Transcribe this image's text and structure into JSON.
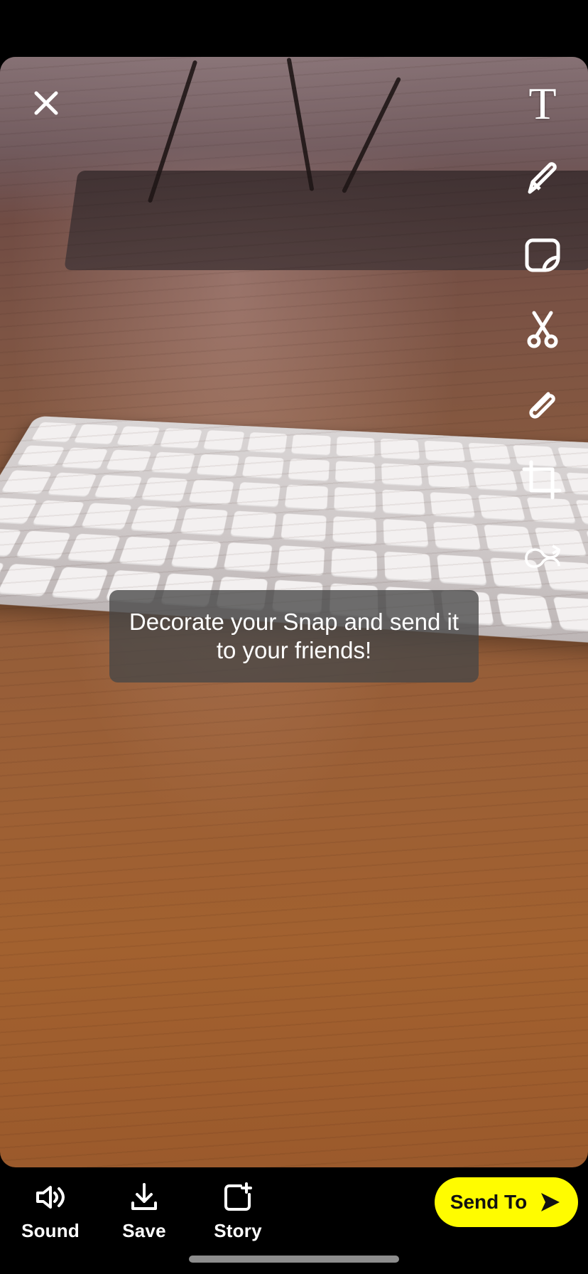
{
  "tooltip": {
    "text": "Decorate your Snap and send it to your friends!"
  },
  "toolbar_right": [
    {
      "name": "text-tool",
      "icon": "text-T-icon"
    },
    {
      "name": "pencil-tool",
      "icon": "pencil-icon"
    },
    {
      "name": "sticker-tool",
      "icon": "sticker-icon"
    },
    {
      "name": "scissors-tool",
      "icon": "scissors-icon"
    },
    {
      "name": "paperclip-tool",
      "icon": "paperclip-icon"
    },
    {
      "name": "crop-tool",
      "icon": "crop-icon"
    },
    {
      "name": "loop-tool",
      "icon": "loop-icon"
    }
  ],
  "bottom": {
    "sound_label": "Sound",
    "save_label": "Save",
    "story_label": "Story",
    "send_label": "Send To"
  },
  "icons": {
    "close": "close-icon",
    "sound": "sound-icon",
    "save": "download-icon",
    "story": "story-add-icon",
    "send": "send-arrow-icon"
  },
  "colors": {
    "send_button": "#fffc00",
    "tooltip_bg": "#464646"
  },
  "text_tool_glyph": "T"
}
